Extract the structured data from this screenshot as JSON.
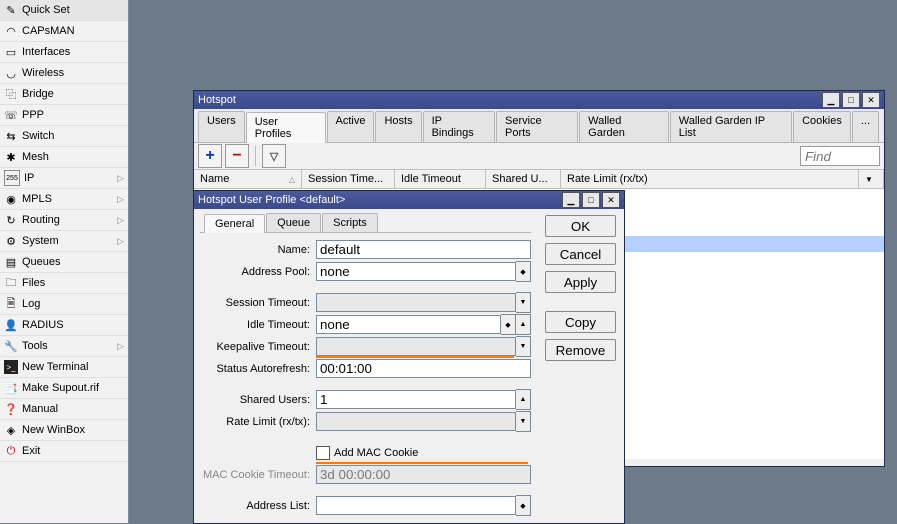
{
  "sidebar": {
    "items": [
      {
        "label": "Quick Set",
        "icon": "⚙",
        "arrow": false
      },
      {
        "label": "CAPsMAN",
        "icon": "📶",
        "arrow": false
      },
      {
        "label": "Interfaces",
        "icon": "▭",
        "arrow": false
      },
      {
        "label": "Wireless",
        "icon": "📡",
        "arrow": false
      },
      {
        "label": "Bridge",
        "icon": "🔀",
        "arrow": false
      },
      {
        "label": "PPP",
        "icon": "☎",
        "arrow": false
      },
      {
        "label": "Switch",
        "icon": "⇆",
        "arrow": false
      },
      {
        "label": "Mesh",
        "icon": "✱",
        "arrow": false
      },
      {
        "label": "IP",
        "icon": "255",
        "arrow": true
      },
      {
        "label": "MPLS",
        "icon": "◉",
        "arrow": true
      },
      {
        "label": "Routing",
        "icon": "↻",
        "arrow": true
      },
      {
        "label": "System",
        "icon": "⚙",
        "arrow": true
      },
      {
        "label": "Queues",
        "icon": "▤",
        "arrow": false
      },
      {
        "label": "Files",
        "icon": "📁",
        "arrow": false
      },
      {
        "label": "Log",
        "icon": "📄",
        "arrow": false
      },
      {
        "label": "RADIUS",
        "icon": "👤",
        "arrow": false
      },
      {
        "label": "Tools",
        "icon": "🔧",
        "arrow": true
      },
      {
        "label": "New Terminal",
        "icon": ">_",
        "arrow": false
      },
      {
        "label": "Make Supout.rif",
        "icon": "📑",
        "arrow": false
      },
      {
        "label": "Manual",
        "icon": "❓",
        "arrow": false
      },
      {
        "label": "New WinBox",
        "icon": "◈",
        "arrow": false
      },
      {
        "label": "Exit",
        "icon": "⏻",
        "arrow": false
      }
    ]
  },
  "hotspot_window": {
    "title": "Hotspot",
    "tabs": [
      "Users",
      "User Profiles",
      "Active",
      "Hosts",
      "IP Bindings",
      "Service Ports",
      "Walled Garden",
      "Walled Garden IP List",
      "Cookies",
      "..."
    ],
    "active_tab": "User Profiles",
    "find_placeholder": "Find",
    "columns": [
      "Name",
      "Session Time...",
      "Idle Timeout",
      "Shared U...",
      "Rate Limit (rx/tx)"
    ]
  },
  "profile_dialog": {
    "title": "Hotspot User Profile <default>",
    "tabs": [
      "General",
      "Queue",
      "Scripts"
    ],
    "active_tab": "General",
    "buttons": {
      "ok": "OK",
      "cancel": "Cancel",
      "apply": "Apply",
      "copy": "Copy",
      "remove": "Remove"
    },
    "fields": {
      "name_label": "Name:",
      "name_value": "default",
      "address_pool_label": "Address Pool:",
      "address_pool_value": "none",
      "session_timeout_label": "Session Timeout:",
      "session_timeout_value": "",
      "idle_timeout_label": "Idle Timeout:",
      "idle_timeout_value": "none",
      "keepalive_timeout_label": "Keepalive Timeout:",
      "keepalive_timeout_value": "",
      "status_autorefresh_label": "Status Autorefresh:",
      "status_autorefresh_value": "00:01:00",
      "shared_users_label": "Shared Users:",
      "shared_users_value": "1",
      "rate_limit_label": "Rate Limit (rx/tx):",
      "rate_limit_value": "",
      "add_mac_cookie_label": "Add MAC Cookie",
      "mac_cookie_timeout_label": "MAC Cookie Timeout:",
      "mac_cookie_timeout_value": "3d 00:00:00",
      "address_list_label": "Address List:",
      "address_list_value": ""
    }
  }
}
